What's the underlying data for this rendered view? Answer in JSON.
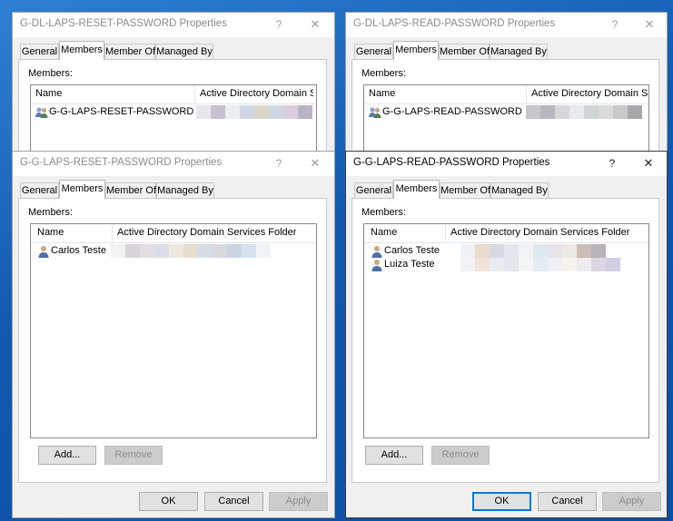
{
  "dialogs": [
    {
      "title": "G-DL-LAPS-RESET-PASSWORD Properties",
      "tabs": [
        "General",
        "Members",
        "Member Of",
        "Managed By"
      ],
      "members_label": "Members:",
      "columns": [
        "Name",
        "Active Directory Domain Servic"
      ],
      "members": [
        "G-G-LAPS-RESET-PASSWORD"
      ]
    },
    {
      "title": "G-DL-LAPS-READ-PASSWORD Properties",
      "tabs": [
        "General",
        "Members",
        "Member Of",
        "Managed By"
      ],
      "members_label": "Members:",
      "columns": [
        "Name",
        "Active Directory Domain Servic"
      ],
      "members": [
        "G-G-LAPS-READ-PASSWORD"
      ]
    },
    {
      "title": "G-G-LAPS-RESET-PASSWORD Properties",
      "tabs": [
        "General",
        "Members",
        "Member Of",
        "Managed By"
      ],
      "members_label": "Members:",
      "columns": [
        "Name",
        "Active Directory Domain Services Folder"
      ],
      "members": [
        "Carlos Teste"
      ],
      "add_label": "Add...",
      "remove_label": "Remove",
      "ok_label": "OK",
      "cancel_label": "Cancel",
      "apply_label": "Apply"
    },
    {
      "title": "G-G-LAPS-READ-PASSWORD Properties",
      "tabs": [
        "General",
        "Members",
        "Member Of",
        "Managed By"
      ],
      "members_label": "Members:",
      "columns": [
        "Name",
        "Active Directory Domain Services Folder"
      ],
      "members": [
        "Carlos Teste",
        "Luiza Teste"
      ],
      "add_label": "Add...",
      "remove_label": "Remove",
      "ok_label": "OK",
      "cancel_label": "Cancel",
      "apply_label": "Apply"
    }
  ],
  "icons": {
    "help": "?",
    "close": "✕",
    "group_icon": "group-icon",
    "user_icon": "user-icon"
  },
  "colors": {
    "desktop": "#1565b8",
    "default_button_border": "#0078d7"
  }
}
